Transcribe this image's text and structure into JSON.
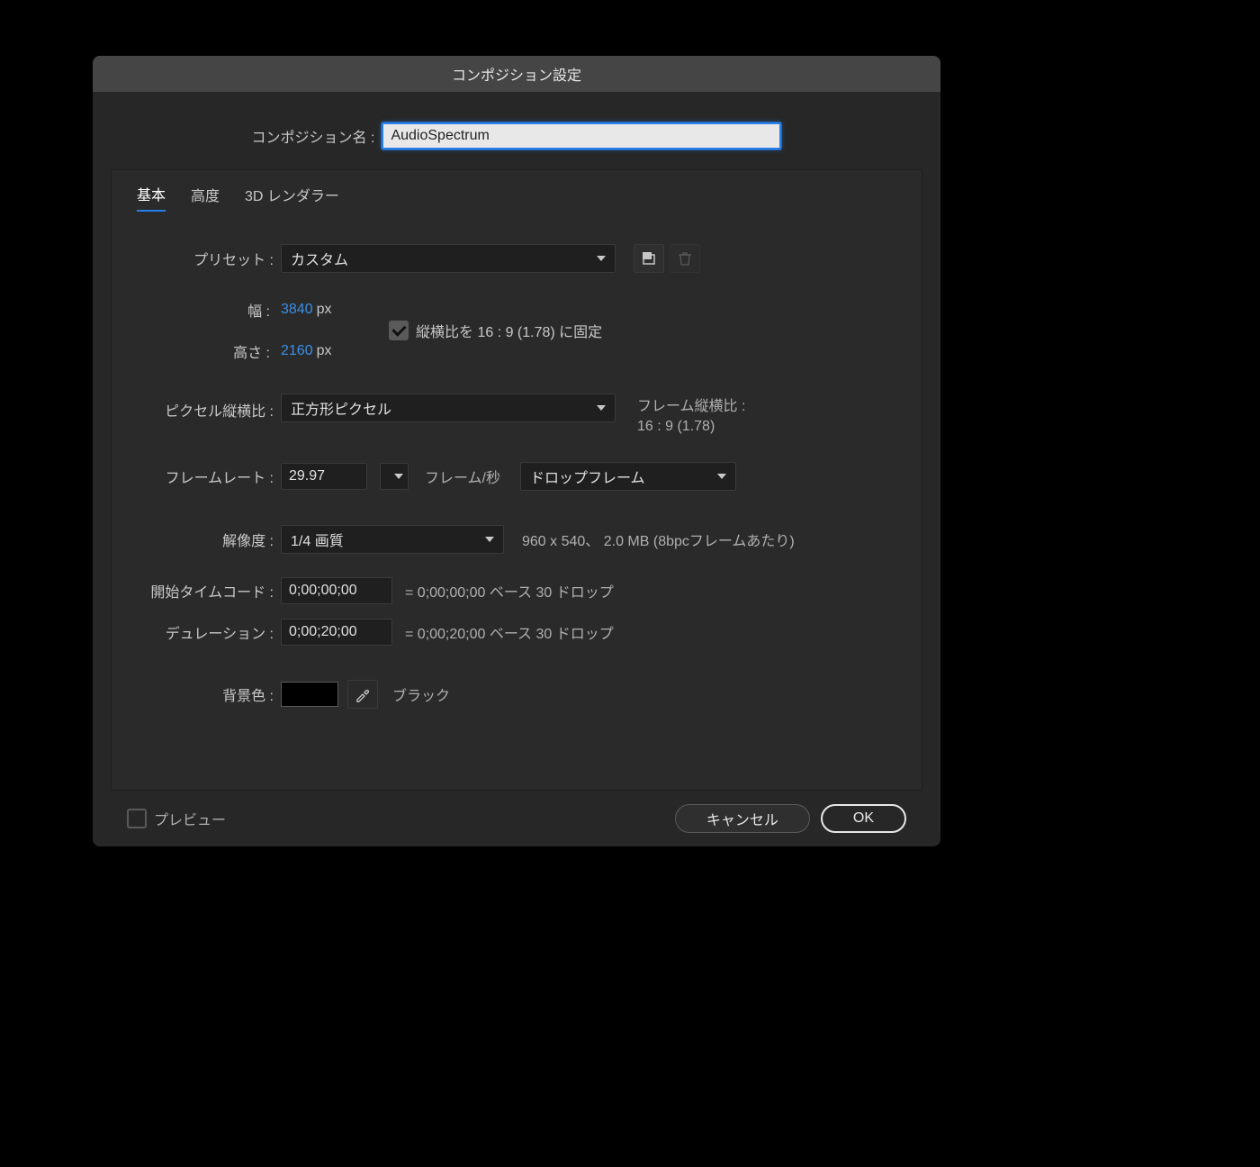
{
  "dialog_title": "コンポジション設定",
  "comp_name_label": "コンポジション名 :",
  "comp_name_value": "AudioSpectrum",
  "tabs": {
    "basic": "基本",
    "advanced": "高度",
    "renderer": "3D レンダラー"
  },
  "preset": {
    "label": "プリセット :",
    "value": "カスタム"
  },
  "width": {
    "label": "幅 :",
    "value": "3840",
    "unit": "px"
  },
  "height": {
    "label": "高さ :",
    "value": "2160",
    "unit": "px"
  },
  "lock_aspect": "縦横比を 16 : 9 (1.78) に固定",
  "pixel_aspect": {
    "label": "ピクセル縦横比 :",
    "value": "正方形ピクセル"
  },
  "frame_aspect": {
    "label": "フレーム縦横比 :",
    "value": "16 : 9 (1.78)"
  },
  "framerate": {
    "label": "フレームレート :",
    "value": "29.97",
    "fps_label": "フレーム/秒",
    "drop_value": "ドロップフレーム"
  },
  "resolution": {
    "label": "解像度 :",
    "value": "1/4 画質",
    "hint": "960 x 540、 2.0 MB (8bpcフレームあたり)"
  },
  "start_tc": {
    "label": "開始タイムコード :",
    "value": "0;00;00;00",
    "hint": "= 0;00;00;00 ベース 30  ドロップ"
  },
  "duration": {
    "label": "デュレーション :",
    "value": "0;00;20;00",
    "hint": "= 0;00;20;00 ベース 30  ドロップ"
  },
  "bg": {
    "label": "背景色 :",
    "name": "ブラック",
    "color": "#000000"
  },
  "preview_label": "プレビュー",
  "cancel": "キャンセル",
  "ok": "OK"
}
